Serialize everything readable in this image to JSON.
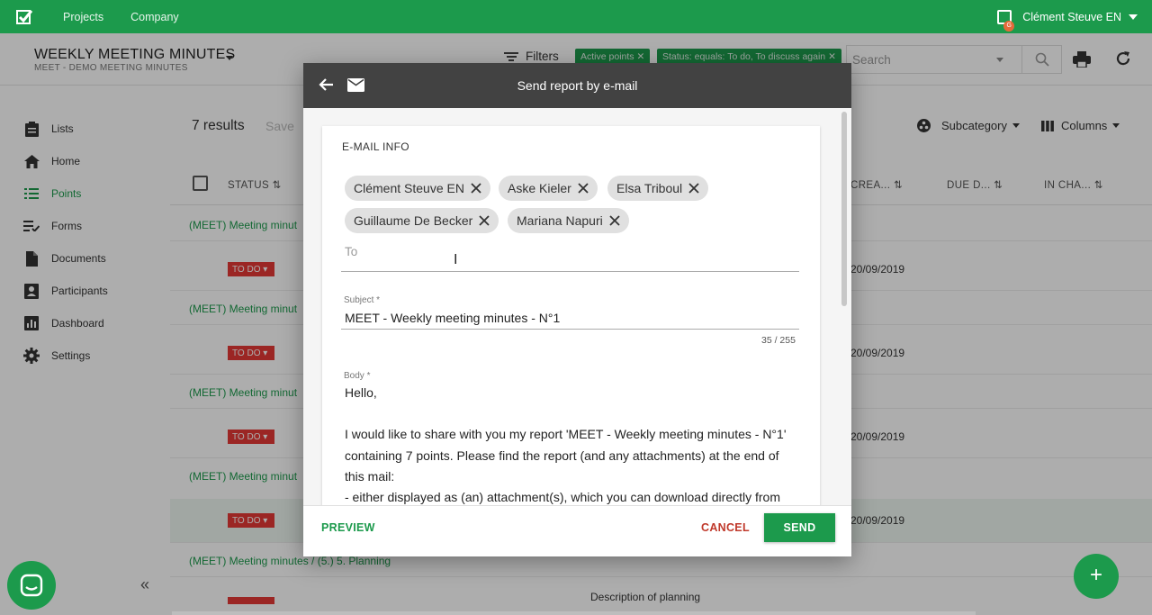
{
  "topbar": {
    "nav": [
      "Projects",
      "Company"
    ],
    "user_name": "Clément Steuve EN",
    "user_badge": "G"
  },
  "header": {
    "title": "WEEKLY MEETING MINUTES",
    "subtitle": "MEET - DEMO MEETING MINUTES",
    "filters_label": "Filters",
    "filter_chips": [
      "Active points",
      "Status: equals: To do, To discuss again"
    ],
    "search_placeholder": "Search"
  },
  "sidebar": {
    "items": [
      {
        "label": "Lists",
        "icon": "clipboard-icon"
      },
      {
        "label": "Home",
        "icon": "home-icon"
      },
      {
        "label": "Points",
        "icon": "list-icon",
        "active": true
      },
      {
        "label": "Forms",
        "icon": "checklist-icon"
      },
      {
        "label": "Documents",
        "icon": "document-icon"
      },
      {
        "label": "Participants",
        "icon": "participants-icon"
      },
      {
        "label": "Dashboard",
        "icon": "dashboard-icon"
      },
      {
        "label": "Settings",
        "icon": "gear-icon"
      }
    ],
    "collapse": "«"
  },
  "list": {
    "results": "7 results",
    "save": "Save",
    "subcategory": "Subcategory",
    "columns": "Columns",
    "headers": {
      "status": "STATUS",
      "created": "CREA...",
      "due": "DUE D...",
      "in_charge": "IN CHA..."
    },
    "groups": [
      "(MEET) Meeting minut",
      "(MEET) Meeting minut",
      "(MEET) Meeting minut",
      "(MEET) Meeting minut",
      "(MEET) Meeting minutes / (5.) 5. Planning"
    ],
    "status": "TO DO",
    "dates": [
      "20/09/2019",
      "20/09/2019",
      "20/09/2019",
      "20/09/2019"
    ],
    "last_desc": "Description of planning"
  },
  "dialog": {
    "title": "Send report by e-mail",
    "section": "E-MAIL INFO",
    "recipients": [
      "Clément Steuve EN",
      "Aske Kieler",
      "Elsa Triboul",
      "Guillaume De Becker",
      "Mariana Napuri"
    ],
    "to_placeholder": "To",
    "subject_label": "Subject *",
    "subject_value": "MEET - Weekly meeting minutes - N°1",
    "subject_counter": "35 / 255",
    "body_label": "Body *",
    "body_lines": [
      "Hello,",
      "",
      "I would like to share with you my report 'MEET - Weekly meeting minutes - N°1'",
      "containing 7 points. Please find the report (and any attachments) at the end of",
      "this mail:",
      "- either displayed as (an) attachment(s), which you can download directly from"
    ],
    "preview": "PREVIEW",
    "cancel": "CANCEL",
    "send": "SEND"
  },
  "colors": {
    "brand": "#1c9a4c",
    "danger": "#e53935",
    "dialog_header": "#424242"
  }
}
